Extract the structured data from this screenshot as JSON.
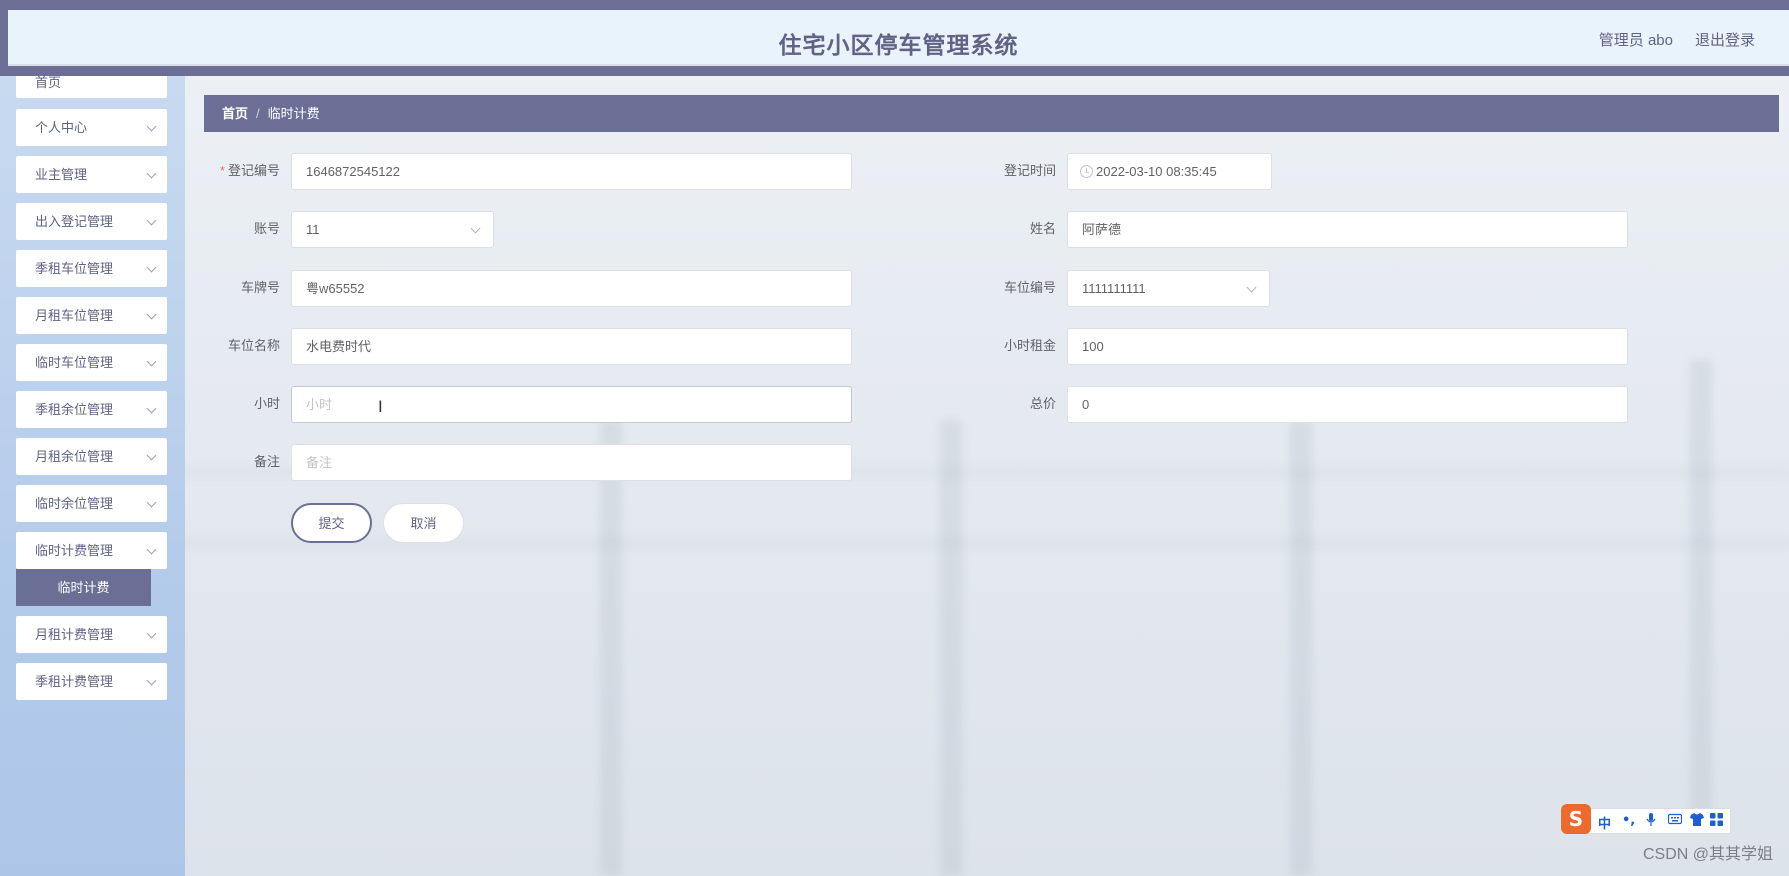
{
  "header": {
    "title": "住宅小区停车管理系统",
    "admin": "管理员 abo",
    "logout": "退出登录"
  },
  "sidebar": {
    "items": [
      {
        "label": "首页"
      },
      {
        "label": "个人中心"
      },
      {
        "label": "业主管理"
      },
      {
        "label": "出入登记管理"
      },
      {
        "label": "季租车位管理"
      },
      {
        "label": "月租车位管理"
      },
      {
        "label": "临时车位管理"
      },
      {
        "label": "季租余位管理"
      },
      {
        "label": "月租余位管理"
      },
      {
        "label": "临时余位管理"
      },
      {
        "label": "临时计费管理"
      },
      {
        "label": "月租计费管理"
      },
      {
        "label": "季租计费管理"
      }
    ],
    "active_sub": "临时计费"
  },
  "breadcrumb": {
    "home": "首页",
    "separator": "/",
    "current": "临时计费"
  },
  "form": {
    "reg_no": {
      "label": "登记编号",
      "value": "1646872545122",
      "required_mark": "*"
    },
    "reg_time": {
      "label": "登记时间",
      "value": "2022-03-10 08:35:45"
    },
    "account": {
      "label": "账号",
      "value": "11"
    },
    "name": {
      "label": "姓名",
      "value": "阿萨德"
    },
    "plate": {
      "label": "车牌号",
      "value": "粤w65552"
    },
    "space_no": {
      "label": "车位编号",
      "value": "1111111111"
    },
    "space_name": {
      "label": "车位名称",
      "value": "水电费时代"
    },
    "hourly_rent": {
      "label": "小时租金",
      "value": "100"
    },
    "hours": {
      "label": "小时",
      "placeholder": "小时",
      "value": ""
    },
    "total": {
      "label": "总价",
      "value": "0"
    },
    "remark": {
      "label": "备注",
      "placeholder": "备注",
      "value": ""
    }
  },
  "actions": {
    "submit": "提交",
    "cancel": "取消"
  },
  "ime": {
    "logo": "S",
    "lang": "中",
    "punct": "•,"
  },
  "watermark": "CSDN @其其学姐",
  "colors": {
    "primary": "#6b6f95",
    "header_bg": "#e9f3fb",
    "sidebar_bg": "#b4cceb",
    "required": "#f56c6c"
  }
}
